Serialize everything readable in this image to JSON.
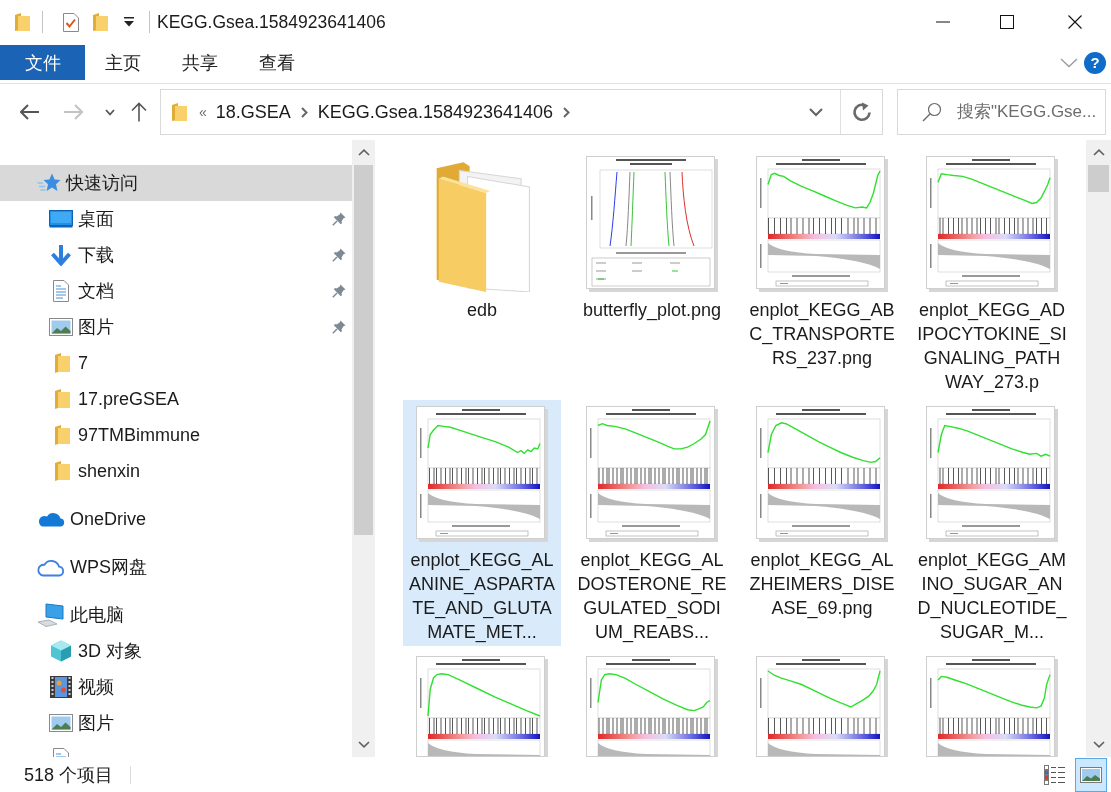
{
  "window": {
    "title": "KEGG.Gsea.1584923641406"
  },
  "ribbon": {
    "tabs": [
      {
        "label": "文件",
        "kind": "file"
      },
      {
        "label": "主页",
        "kind": "tab"
      },
      {
        "label": "共享",
        "kind": "tab"
      },
      {
        "label": "查看",
        "kind": "tab"
      }
    ],
    "help": "?"
  },
  "address_bar": {
    "forward_disabled": true,
    "overflow": "«",
    "path": [
      "18.GSEA",
      "KEGG.Gsea.1584923641406"
    ]
  },
  "search": {
    "placeholder": "搜索\"KEGG.Gse..."
  },
  "navigation": {
    "items": [
      {
        "label": "快速访问",
        "kind": "quick",
        "selected": true,
        "children": [
          {
            "label": "桌面",
            "kind": "desktop",
            "pinned": true,
            "selected": false
          },
          {
            "label": "下载",
            "kind": "downloads",
            "pinned": true,
            "selected": false
          },
          {
            "label": "文档",
            "kind": "documents",
            "pinned": true,
            "selected": false
          },
          {
            "label": "图片",
            "kind": "pictures",
            "pinned": true,
            "selected": false
          },
          {
            "label": "7",
            "kind": "folder",
            "pinned": false,
            "selected": false
          },
          {
            "label": "17.preGSEA",
            "kind": "folder",
            "pinned": false,
            "selected": false
          },
          {
            "label": "97TMBimmune",
            "kind": "folder",
            "pinned": false,
            "selected": false
          },
          {
            "label": "shenxin",
            "kind": "folder",
            "pinned": false,
            "selected": false
          }
        ]
      },
      {
        "label": "OneDrive",
        "kind": "onedrive",
        "selected": false
      },
      {
        "label": "WPS网盘",
        "kind": "netdisk",
        "selected": false
      },
      {
        "label": "此电脑",
        "kind": "computer",
        "selected": false,
        "children": [
          {
            "label": "3D 对象",
            "kind": "objects",
            "selected": false
          },
          {
            "label": "视频",
            "kind": "videos",
            "selected": false
          },
          {
            "label": "图片",
            "kind": "pictures",
            "selected": false
          },
          {
            "kind": "documents",
            "selected": false
          }
        ]
      }
    ]
  },
  "files": [
    {
      "name": "edb",
      "kind": "folder",
      "selected": false
    },
    {
      "name": "butterfly_plot.png",
      "kind": "butterfly",
      "selected": false
    },
    {
      "name": "enplot_KEGG_ABC_TRANSPORTERS_237.png",
      "kind": "enrichment",
      "selected": false
    },
    {
      "name": "enplot_KEGG_ADIPOCYTOKINE_SIGNALING_PATHWAY_273.p",
      "kind": "enrichment",
      "selected": false
    },
    {
      "name": "enplot_KEGG_ALANINE_ASPARTATE_AND_GLUTAMATE_MET...",
      "kind": "enrichment",
      "selected": true
    },
    {
      "name": "enplot_KEGG_ALDOSTERONE_REGULATED_SODIUM_REABS...",
      "kind": "enrichment",
      "selected": false
    },
    {
      "name": "enplot_KEGG_ALZHEIMERS_DISEASE_69.png",
      "kind": "enrichment",
      "selected": false
    },
    {
      "name": "enplot_KEGG_AMINO_SUGAR_AND_NUCLEOTIDE_SUGAR_M...",
      "kind": "enrichment",
      "selected": false
    },
    {
      "kind": "enrichment",
      "selected": false
    },
    {
      "kind": "enrichment",
      "selected": false
    },
    {
      "kind": "enrichment",
      "selected": false
    },
    {
      "kind": "enrichment",
      "selected": false
    }
  ],
  "status_bar": {
    "item_count": "518 个项目",
    "views": [
      {
        "kind": "details",
        "selected": false
      },
      {
        "kind": "icons",
        "selected": true
      }
    ]
  }
}
